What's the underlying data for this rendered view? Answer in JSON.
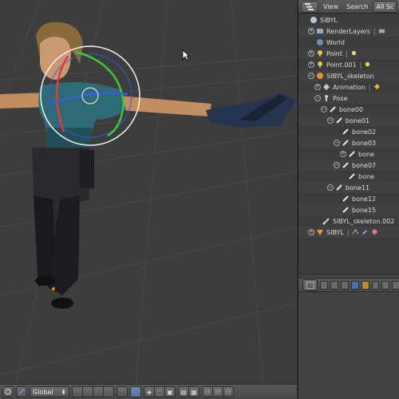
{
  "viewport": {
    "orientation": "Global",
    "background": "#3d3d3d",
    "grid_color": "#4a4a4a",
    "gizmo": {
      "x_color": "#e03c3c",
      "y_color": "#3cc83c",
      "z_color": "#3c5ae0",
      "trackball": "#f0f0f0"
    }
  },
  "outliner": {
    "menu": [
      "View",
      "Search"
    ],
    "filter": "All Sc",
    "tree": [
      {
        "label": "SIBYL",
        "icon": "scene-icon",
        "depth": 0,
        "expander": "",
        "extras": []
      },
      {
        "label": "RenderLayers",
        "icon": "render-layers-icon",
        "depth": 1,
        "expander": "+",
        "extras": [
          "|",
          "camera-icon"
        ]
      },
      {
        "label": "World",
        "icon": "world-icon",
        "depth": 1,
        "expander": "",
        "extras": []
      },
      {
        "label": "Point",
        "icon": "lamp-icon",
        "depth": 1,
        "expander": "+",
        "extras": [
          "|",
          "light-icon"
        ]
      },
      {
        "label": "Point.001",
        "icon": "lamp-icon",
        "depth": 1,
        "expander": "+",
        "extras": [
          "|",
          "light-icon"
        ]
      },
      {
        "label": "SIBYL_skeleton",
        "icon": "armature-icon",
        "depth": 1,
        "expander": "−",
        "extras": []
      },
      {
        "label": "Animation",
        "icon": "animation-icon",
        "depth": 2,
        "expander": "+",
        "extras": [
          "|",
          "action-icon"
        ]
      },
      {
        "label": "Pose",
        "icon": "pose-icon",
        "depth": 2,
        "expander": "−",
        "extras": []
      },
      {
        "label": "bone00",
        "icon": "bone-icon",
        "depth": 3,
        "expander": "−",
        "extras": []
      },
      {
        "label": "bone01",
        "icon": "bone-icon",
        "depth": 4,
        "expander": "−",
        "extras": []
      },
      {
        "label": "bone02",
        "icon": "bone-icon",
        "depth": 5,
        "expander": "",
        "extras": []
      },
      {
        "label": "bone03",
        "icon": "bone-icon",
        "depth": 5,
        "expander": "−",
        "extras": []
      },
      {
        "label": "bone",
        "icon": "bone-icon",
        "depth": 6,
        "expander": "+",
        "extras": []
      },
      {
        "label": "bone07",
        "icon": "bone-icon",
        "depth": 5,
        "expander": "−",
        "extras": []
      },
      {
        "label": "bone",
        "icon": "bone-icon",
        "depth": 6,
        "expander": "",
        "extras": []
      },
      {
        "label": "bone11",
        "icon": "bone-icon",
        "depth": 4,
        "expander": "−",
        "extras": []
      },
      {
        "label": "bone12",
        "icon": "bone-icon",
        "depth": 5,
        "expander": "",
        "extras": []
      },
      {
        "label": "bone15",
        "icon": "bone-icon",
        "depth": 5,
        "expander": "",
        "extras": []
      },
      {
        "label": "SIBYL_skeleton.002",
        "icon": "armature-data-icon",
        "depth": 2,
        "expander": "",
        "extras": []
      },
      {
        "label": "SIBYL",
        "icon": "mesh-icon",
        "depth": 1,
        "expander": "+",
        "extras": [
          "|",
          "modifier-icon",
          "wrench-icon",
          "material-icon"
        ]
      }
    ]
  }
}
